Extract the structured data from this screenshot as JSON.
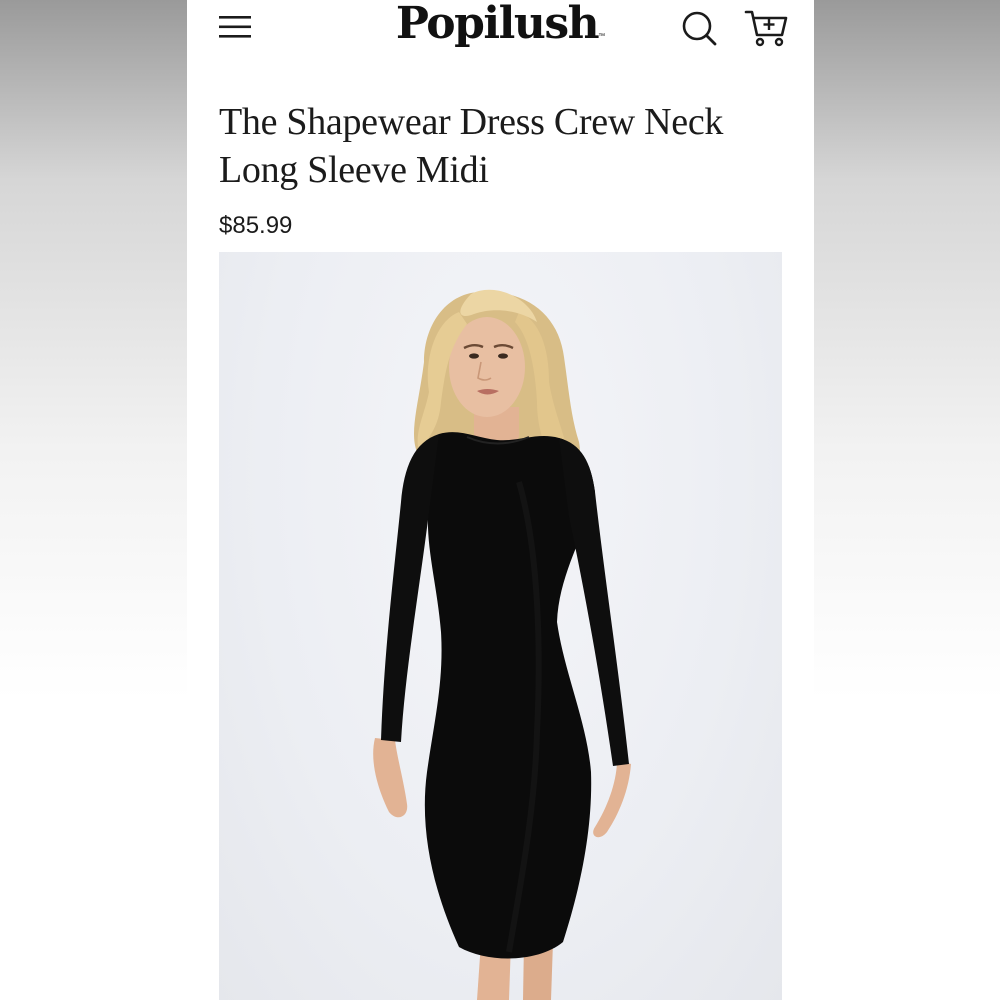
{
  "header": {
    "logo_text": "Popilush",
    "logo_mark": "™",
    "icons": {
      "menu": "hamburger-menu-icon",
      "search": "search-icon",
      "cart": "add-to-cart-icon"
    }
  },
  "product": {
    "title": "The Shapewear Dress Crew Neck Long Sleeve Midi",
    "price": "$85.99",
    "image_subject": "model wearing black long sleeve midi dress"
  },
  "colors": {
    "text": "#1b1b1b",
    "dress": "#0b0b0b",
    "photo_background": "#eceef3"
  }
}
